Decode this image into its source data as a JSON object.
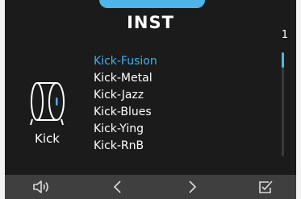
{
  "header": {
    "title": "INST",
    "page_number": "1"
  },
  "instrument": {
    "icon": "kick-drum-icon",
    "name": "Kick"
  },
  "list": {
    "items": [
      {
        "label": "Kick-Fusion",
        "selected": true
      },
      {
        "label": "Kick-Metal",
        "selected": false
      },
      {
        "label": "Kick-Jazz",
        "selected": false
      },
      {
        "label": "Kick-Blues",
        "selected": false
      },
      {
        "label": "Kick-Ying",
        "selected": false
      },
      {
        "label": "Kick-RnB",
        "selected": false
      }
    ],
    "scroll_position": 0.0,
    "scroll_visible_fraction": 0.15
  },
  "bottom_bar": {
    "buttons": [
      {
        "name": "speaker-icon"
      },
      {
        "name": "chevron-left-icon"
      },
      {
        "name": "chevron-right-icon"
      },
      {
        "name": "checkbox-check-icon"
      }
    ]
  },
  "colors": {
    "accent": "#43b0ea",
    "background": "#1b1b1b",
    "bottom_bar": "#3f3f3f",
    "text": "#ffffff"
  }
}
